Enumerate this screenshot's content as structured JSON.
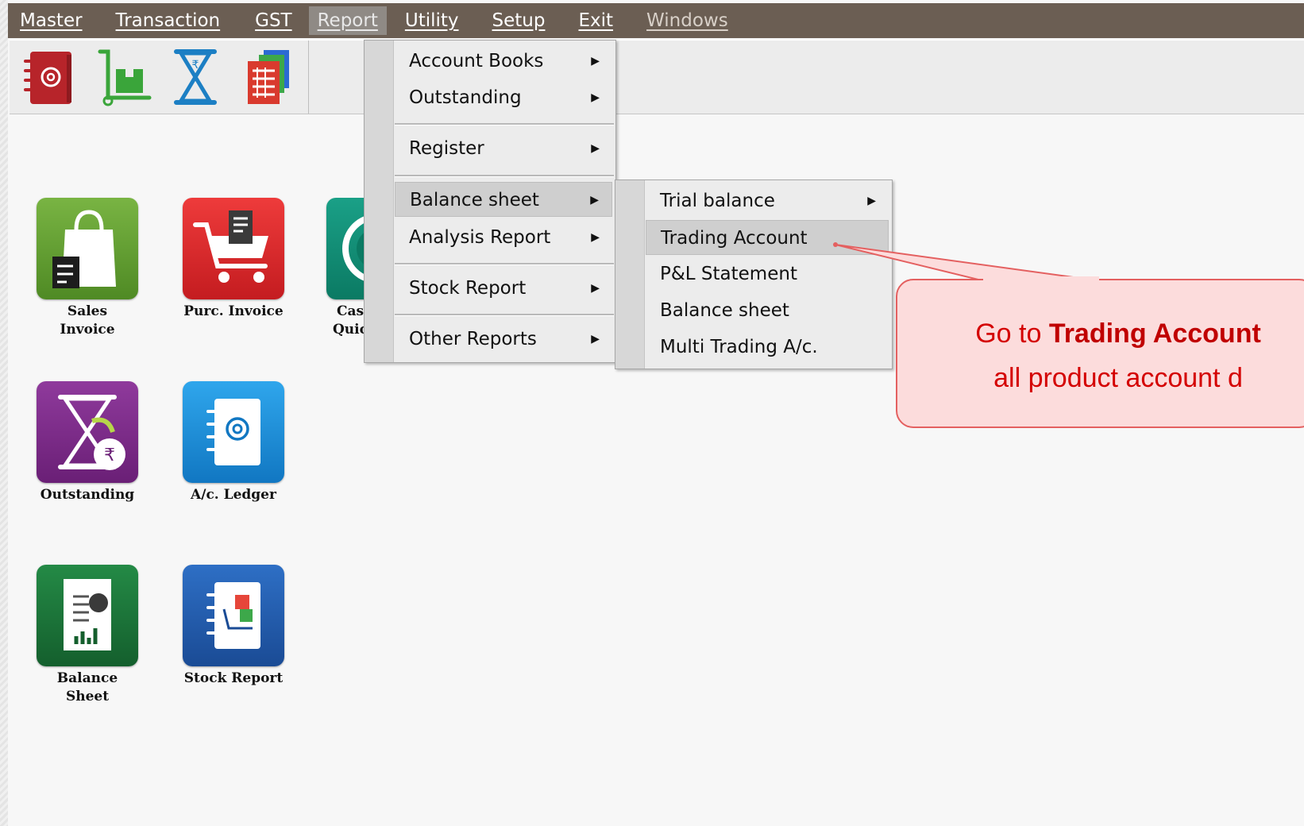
{
  "menubar": {
    "items": [
      {
        "label": "Master"
      },
      {
        "label": "Transaction"
      },
      {
        "label": "GST"
      },
      {
        "label": "Report"
      },
      {
        "label": "Utility"
      },
      {
        "label": "Setup"
      },
      {
        "label": "Exit"
      },
      {
        "label": "Windows"
      }
    ],
    "active": "Report"
  },
  "toolbar": {
    "icons": [
      "address-book-icon",
      "delivery-trolley-icon",
      "hourglass-rupee-icon",
      "report-stack-icon"
    ]
  },
  "desktop": {
    "icons": [
      {
        "label": "Sales Invoice",
        "icon": "shopping-bag-icon",
        "color": "#5e9a2e"
      },
      {
        "label": "Purc. Invoice",
        "icon": "shopping-cart-icon",
        "color": "#d6282a"
      },
      {
        "label": "Cas Quic",
        "icon": "cash-icon",
        "color": "#0f8b73"
      },
      {
        "label": "Outstanding",
        "icon": "hourglass-rupee-icon",
        "color": "#7b2c86"
      },
      {
        "label": "A/c. Ledger",
        "icon": "address-book-icon",
        "color": "#1c8fd6"
      },
      {
        "label": "Balance Sheet",
        "icon": "pie-chart-document-icon",
        "color": "#1f7a3a"
      },
      {
        "label": "Stock Report",
        "icon": "stock-book-icon",
        "color": "#1f57a8"
      }
    ]
  },
  "report_menu": {
    "items": [
      {
        "label": "Account Books",
        "submenu": true
      },
      {
        "label": "Outstanding",
        "submenu": true
      },
      {
        "label": "Register",
        "submenu": true
      },
      {
        "label": "Balance sheet",
        "submenu": true,
        "highlighted": true
      },
      {
        "label": "Analysis Report",
        "submenu": true
      },
      {
        "label": "Stock Report",
        "submenu": true
      },
      {
        "label": "Other Reports",
        "submenu": true
      }
    ]
  },
  "balance_sheet_menu": {
    "items": [
      {
        "label": "Trial balance",
        "submenu": true
      },
      {
        "label": "Trading Account",
        "highlighted": true
      },
      {
        "label": "P&L Statement"
      },
      {
        "label": "Balance sheet"
      },
      {
        "label": "Multi Trading A/c."
      }
    ]
  },
  "callout": {
    "prefix": "Go to ",
    "bold": "Trading Account",
    "line2": "all product account d"
  },
  "colors": {
    "menubar": "#6b5e53",
    "callout_bg": "#fcdcdc",
    "callout_border": "#e46060",
    "callout_text": "#d40000"
  }
}
